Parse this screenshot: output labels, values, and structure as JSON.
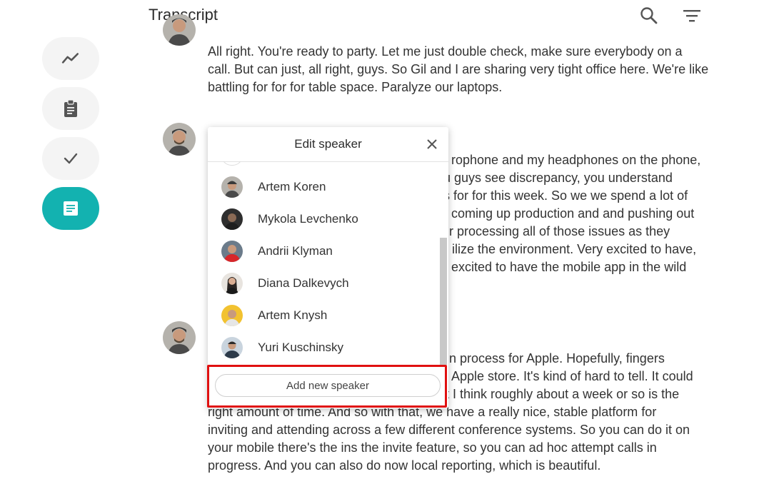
{
  "header": {
    "title": "Transcript",
    "search_icon": "search-icon",
    "filter_icon": "filter-icon"
  },
  "sidebar": {
    "items": [
      {
        "icon": "activity-icon",
        "active": false
      },
      {
        "icon": "clipboard-icon",
        "active": false
      },
      {
        "icon": "check-icon",
        "active": false
      },
      {
        "icon": "notes-icon",
        "active": true
      }
    ],
    "accent": "#13b2b0"
  },
  "transcript": {
    "paragraph1": [
      "All right. You're ready to party. Let me just double check, make sure everybody on a",
      "call. But can just, all right, guys. So Gil and I are sharing very tight office here. We're like",
      "battling for for for table space. Paralyze our laptops."
    ],
    "paragraph2": [
      "rophone and my headphones on the phone,",
      "u guys see discrepancy, you understand",
      "s for for this week. So we we spend a lot of",
      "coming up production and and pushing out",
      "r processing all of those issues as they",
      "ilize the environment. Very excited to have,",
      "excited to have the mobile app in the wild"
    ],
    "paragraph3_partial": [
      "n process for Apple. Hopefully, fingers",
      "Apple store. It's kind of hard to tell. It could",
      "t I think roughly about a week or so is the"
    ],
    "paragraph3": [
      "right amount of time. And so with that, we have a really nice, stable platform for",
      "inviting and attending across a few different conference systems. So you can do it on",
      "your mobile there's the ins the invite feature, so you can ad hoc attempt calls in",
      "progress. And you can also do now local reporting, which is beautiful."
    ]
  },
  "edit_speaker": {
    "title": "Edit speaker",
    "speakers": [
      {
        "name": "Artem Koren"
      },
      {
        "name": "Mykola Levchenko"
      },
      {
        "name": "Andrii Klyman"
      },
      {
        "name": "Diana Dalkevych"
      },
      {
        "name": "Artem Knysh"
      },
      {
        "name": "Yuri Kuschinsky"
      }
    ],
    "add_button": "Add new speaker",
    "highlight_color": "#e01010"
  }
}
